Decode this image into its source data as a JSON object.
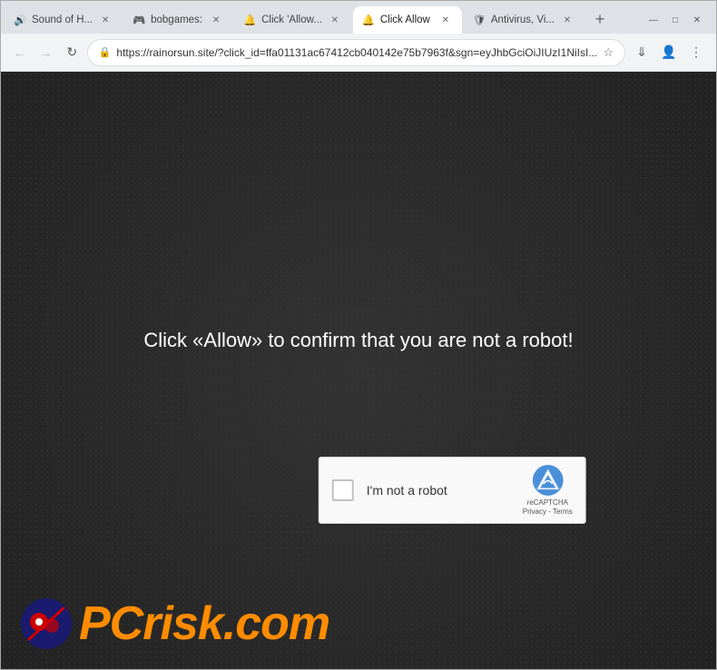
{
  "window": {
    "title": "Click Allow"
  },
  "tabs": [
    {
      "id": "tab1",
      "label": "Sound of H...",
      "active": false,
      "favicon": "🔊"
    },
    {
      "id": "tab2",
      "label": "bobgames:",
      "active": false,
      "favicon": "🎮"
    },
    {
      "id": "tab3",
      "label": "Click 'Allow...",
      "active": false,
      "favicon": "🔔"
    },
    {
      "id": "tab4",
      "label": "Click Allow",
      "active": true,
      "favicon": "🔔"
    },
    {
      "id": "tab5",
      "label": "Antivirus, Vi...",
      "active": false,
      "favicon": "🛡"
    }
  ],
  "window_controls": {
    "minimize": "—",
    "maximize": "□",
    "close": "✕"
  },
  "nav": {
    "back_disabled": true,
    "forward_disabled": true,
    "url": "https://rainorsun.site/?click_id=ffa01131ac67412cb040142e75b7963f&sgn=eyJhbGciOiJIUzI1NiIsI...",
    "url_short": "https://rainorsun.site/?click_id=ffa01131ac67412cb040142e75b7963f&sgn=eyJhbGciOiJIUzI1NiIsI..."
  },
  "page": {
    "main_message": "Click «Allow» to confirm that you are not a robot!",
    "background_color": "#2b2b2b"
  },
  "recaptcha": {
    "checkbox_label": "I'm not a robot",
    "brand_line1": "reCAPTCHA",
    "brand_line2": "Privacy - Terms"
  },
  "watermark": {
    "prefix": "PC",
    "suffix": "risk.com"
  }
}
